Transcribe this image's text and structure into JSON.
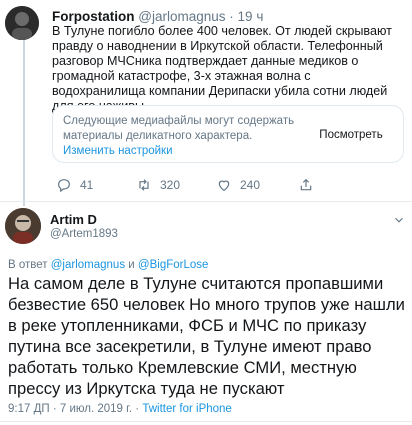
{
  "tweet1": {
    "display_name": "Forpostation",
    "handle": "@jarlomagnus",
    "separator": "·",
    "time": "19 ч",
    "text": "В Тулуне погибло более 400 человек.  От людей скрывают правду о наводнении в Иркутской области. Телефонный разговор МЧСника подтверждает данные медиков о громадной катастрофе, 3-х этажная волна с водохранилища компании Дерипаски убила сотни людей для его наживы.",
    "media_warning": {
      "text": "Следующие медиафайлы могут содержать материалы деликатного характера.",
      "settings_link": "Изменить настройки",
      "view_button": "Посмотреть"
    },
    "actions": {
      "reply_count": "41",
      "retweet_count": "320",
      "like_count": "240"
    }
  },
  "tweet2": {
    "display_name": "Artim D",
    "handle": "@Artem1893",
    "reply_prefix": "В ответ",
    "reply_user1": "@jarlomagnus",
    "reply_and": "и",
    "reply_user2": "@BigForLose",
    "text": "На самом деле в Тулуне считаются пропавшими безвестие 650 человек    Но много трупов уже нашли в реке утопленниками, ФСБ и МЧС по приказу путина все засекретили, в Тулуне имеют право работать только Кремлевские СМИ, местную прессу из Иркутска туда не пускают",
    "timestamp": "9:17 ДП · 7 июл. 2019 г. ·",
    "source": "Twitter for iPhone"
  },
  "icons": {
    "reply": "reply-icon",
    "retweet": "retweet-icon",
    "like": "heart-icon",
    "share": "share-icon",
    "menu": "chevron-down-icon"
  },
  "colors": {
    "accent": "#1b95e0",
    "secondary_text": "#657786",
    "border": "#e1e8ed"
  }
}
